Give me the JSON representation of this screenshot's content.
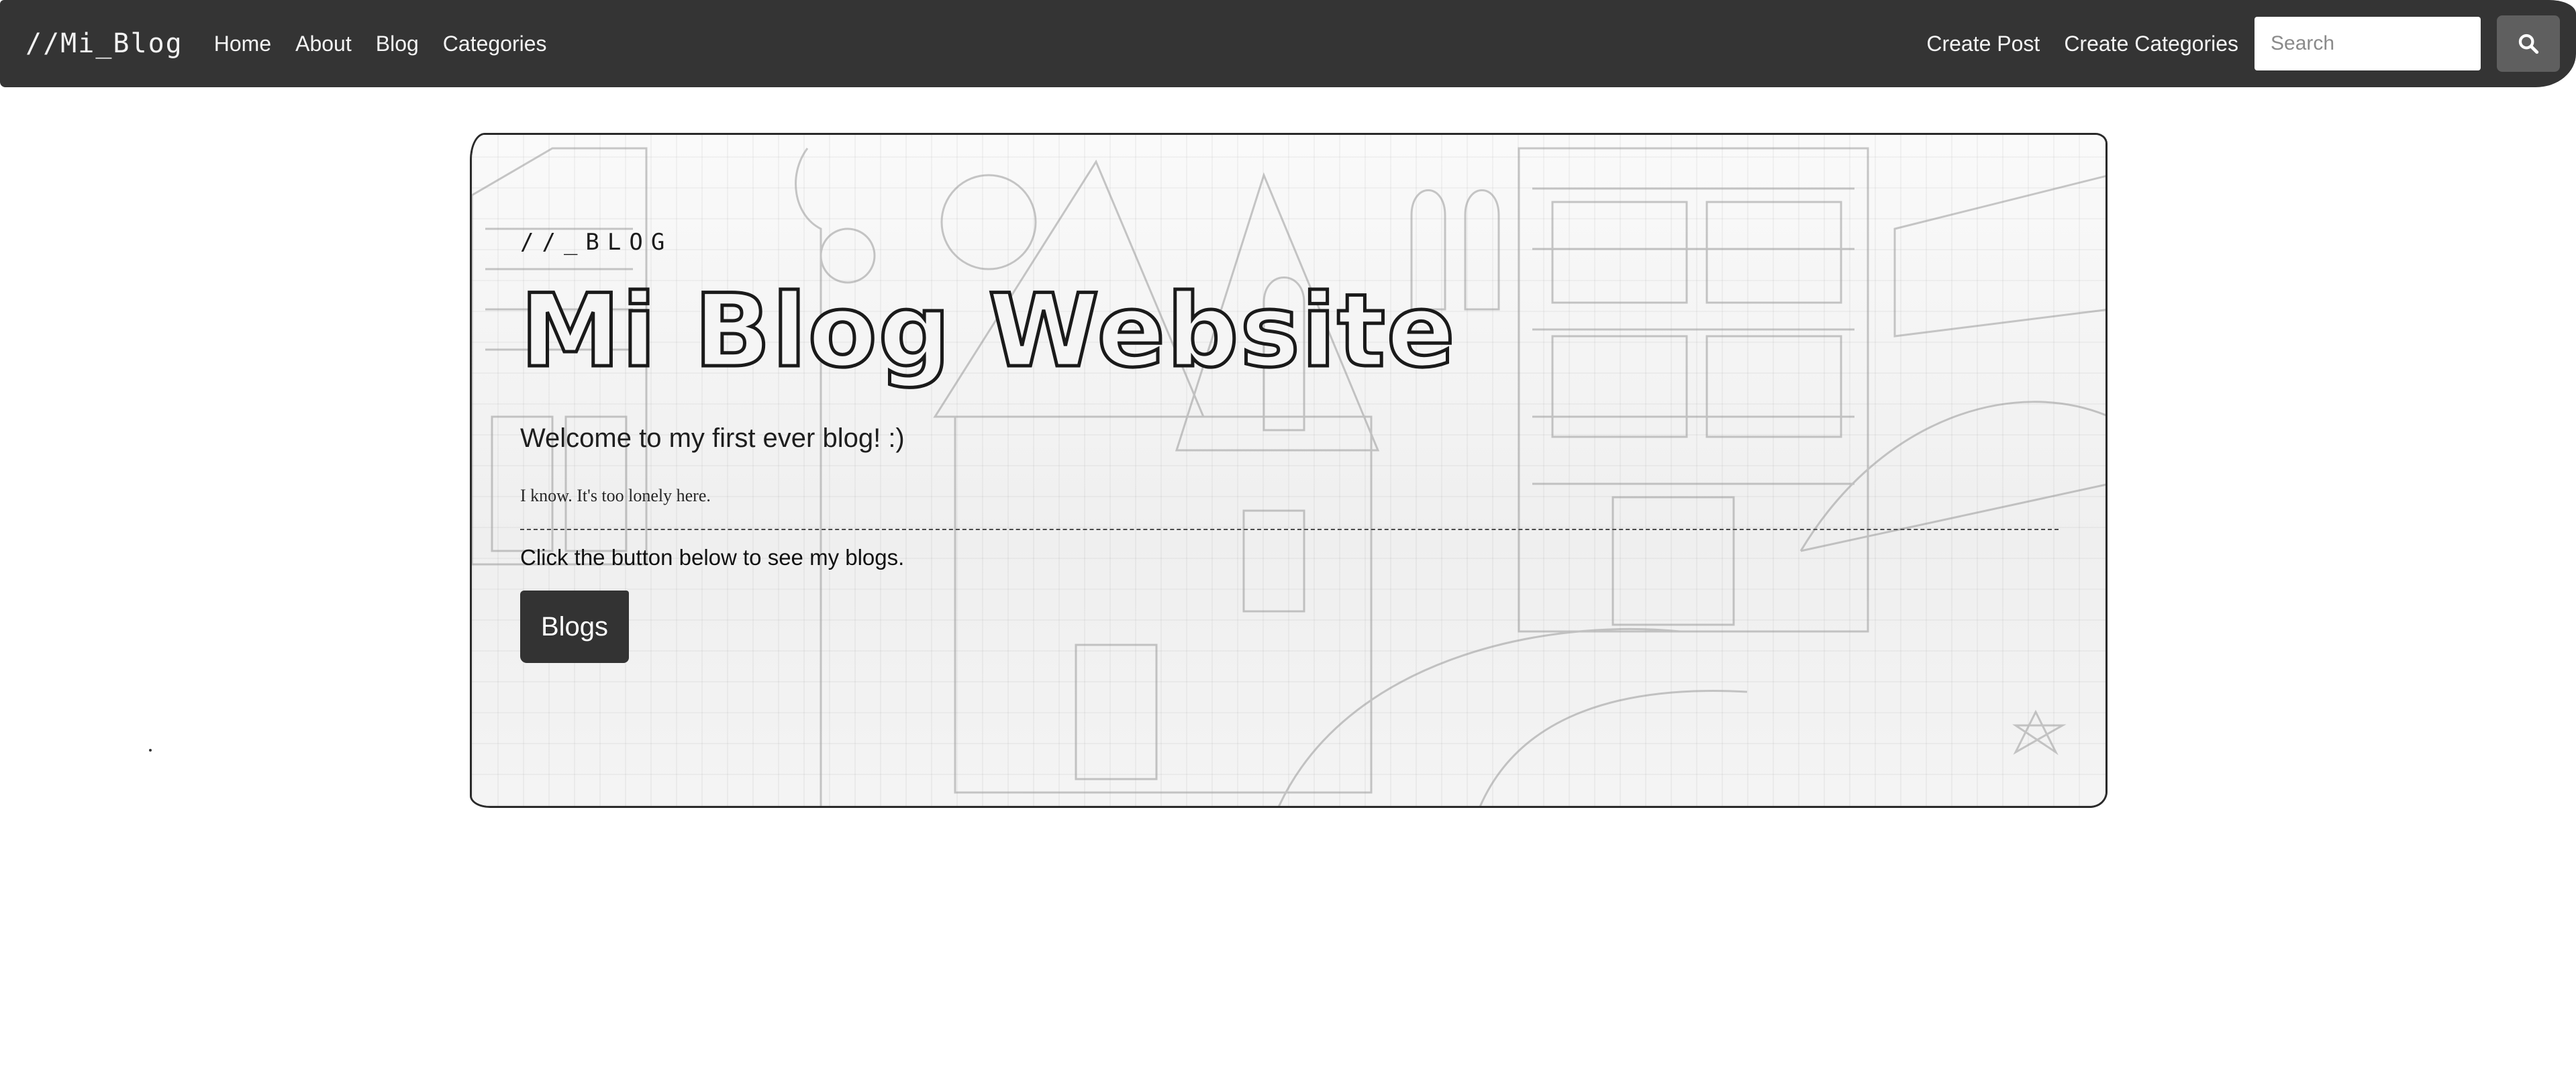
{
  "navbar": {
    "brand": "//Mi_Blog",
    "links": [
      "Home",
      "About",
      "Blog",
      "Categories"
    ],
    "right_links": [
      "Create Post",
      "Create Categories"
    ],
    "search_placeholder": "Search",
    "search_icon": "search-icon"
  },
  "hero": {
    "kicker": "//_BLOG",
    "title": "Mi Blog Website",
    "lead": "Welcome to my first ever blog! :)",
    "note": "I know. It's too lonely here.",
    "cta_text": "Click the button below to see my blogs.",
    "button_label": "Blogs"
  },
  "colors": {
    "navbar_bg": "#343434",
    "button_bg": "#333333",
    "search_button_bg": "#5f5f5f"
  }
}
